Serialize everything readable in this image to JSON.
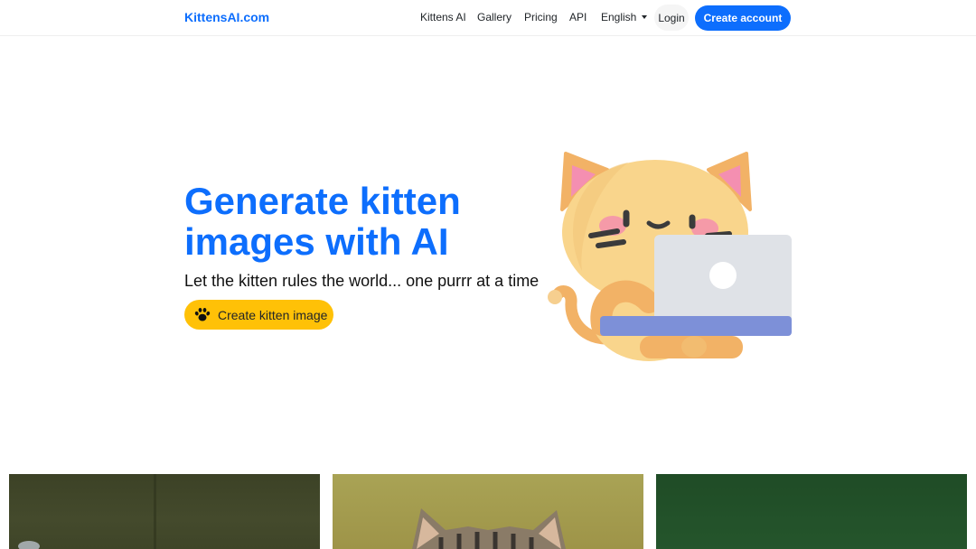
{
  "header": {
    "brand": "KittensAI.com",
    "nav": {
      "kittens_ai": "Kittens AI",
      "gallery": "Gallery",
      "pricing": "Pricing",
      "api": "API",
      "language": "English"
    },
    "login": "Login",
    "create_account": "Create account"
  },
  "hero": {
    "title": "Generate kitten images with AI",
    "subtitle": "Let the kitten rules the world... one purrr at a time",
    "cta": "Create kitten image",
    "cta_icon": "paw-icon"
  },
  "colors": {
    "brand": "#0d6efd",
    "cta": "#ffc107"
  },
  "gallery": {
    "cards": [
      {
        "name": "kitten-image-1"
      },
      {
        "name": "kitten-image-2"
      },
      {
        "name": "kitten-image-3"
      }
    ]
  }
}
